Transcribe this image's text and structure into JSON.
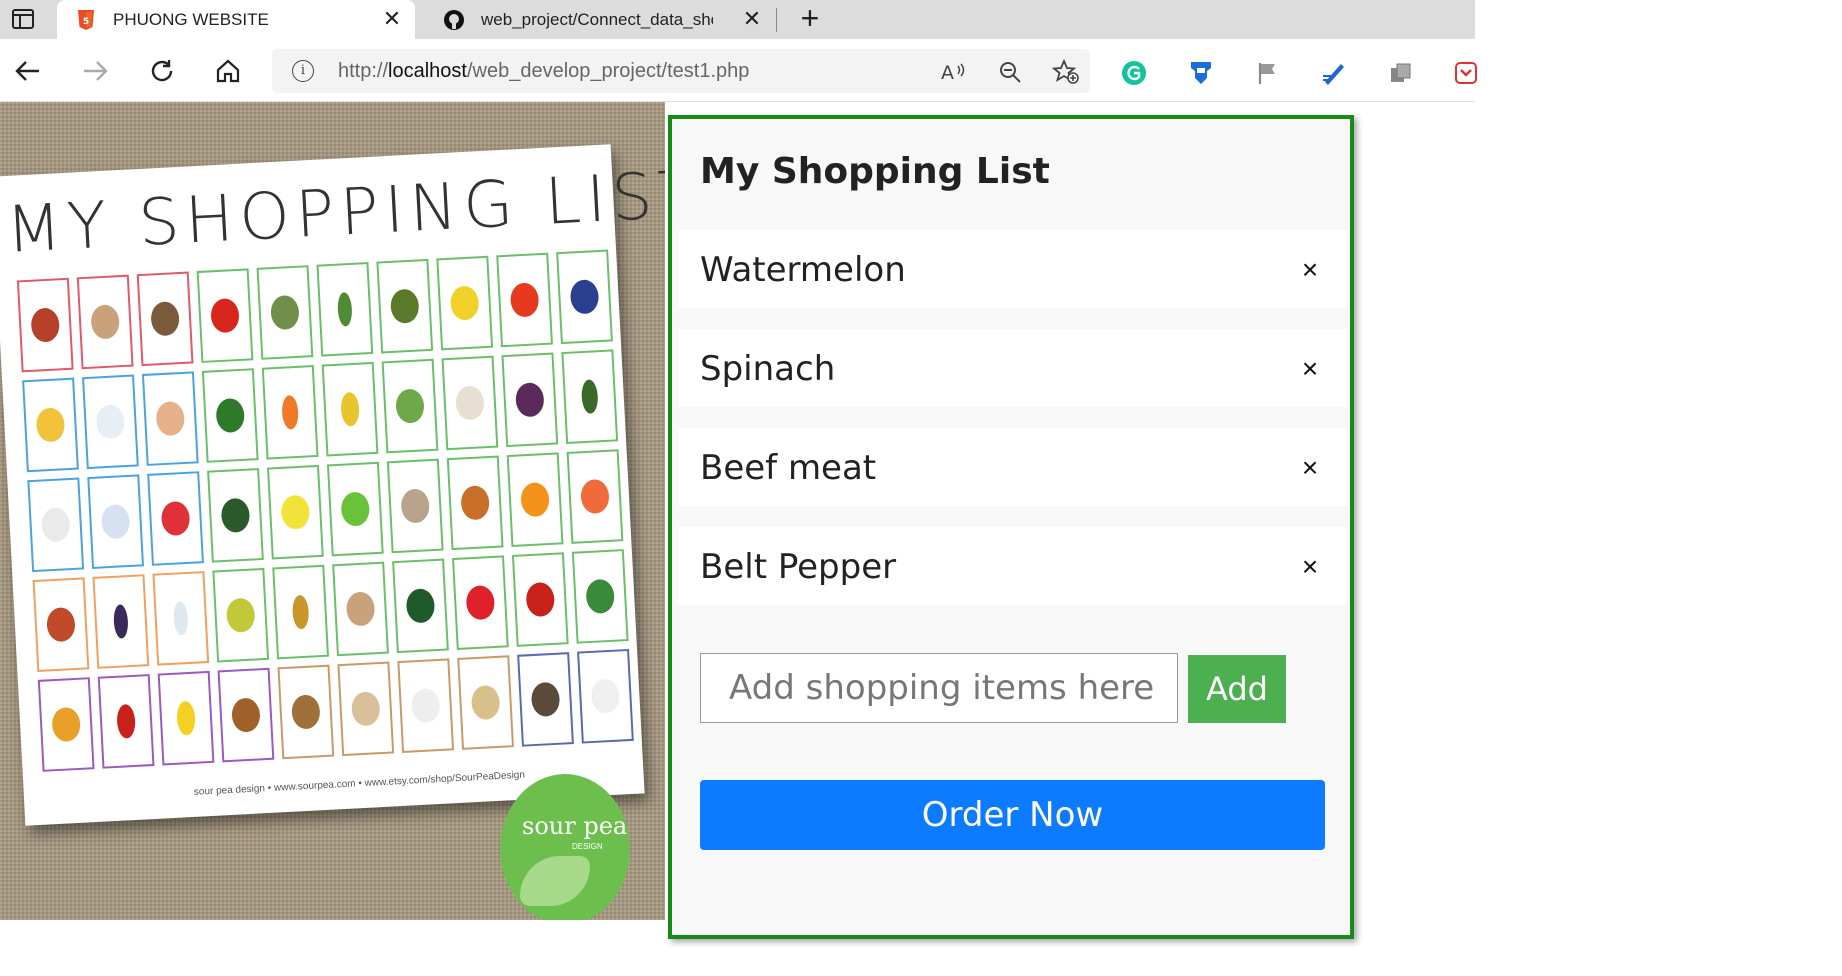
{
  "browser": {
    "tabs": [
      {
        "title": "PHUONG WEBSITE",
        "favicon": "html5-icon",
        "active": true
      },
      {
        "title": "web_project/Connect_data_shop",
        "favicon": "github-icon",
        "active": false
      }
    ],
    "address": {
      "prefix": "http://",
      "host": "localhost",
      "path": "/web_develop_project/test1.php"
    }
  },
  "poster": {
    "title": "MY SHOPPING LIST",
    "footer": "sour pea design • www.sourpea.com • www.etsy.com/shop/SourPeaDesign",
    "badge_text": "sour pea",
    "badge_sub": "DESIGN"
  },
  "shopping": {
    "title": "My Shopping List",
    "items": [
      {
        "label": "Watermelon"
      },
      {
        "label": "Spinach"
      },
      {
        "label": "Beef meat"
      },
      {
        "label": "Belt Pepper"
      }
    ],
    "remove_symbol": "×",
    "input_placeholder": "Add shopping items here",
    "add_label": "Add",
    "order_label": "Order Now"
  },
  "colors": {
    "panel_border": "#188a18",
    "add_button": "#4caf50",
    "order_button": "#0d7bff"
  }
}
